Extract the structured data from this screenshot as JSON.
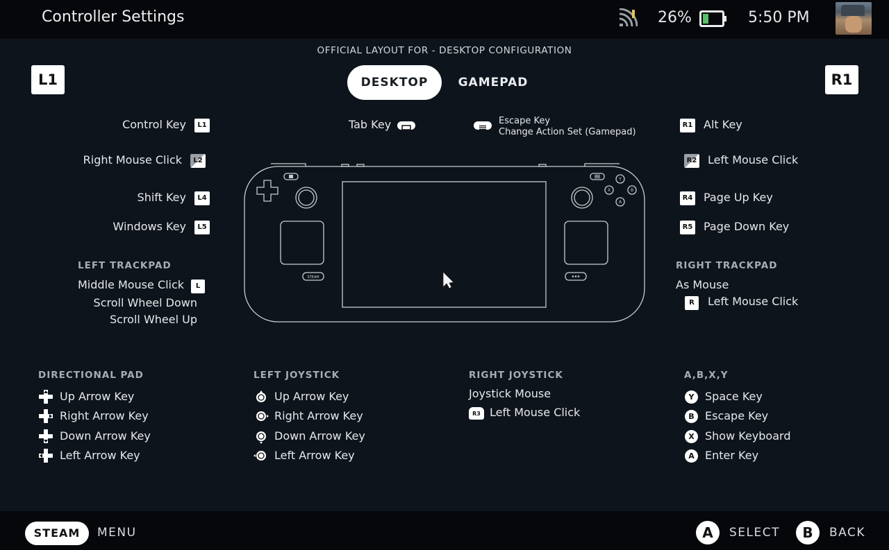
{
  "header": {
    "title": "Controller Settings",
    "battery": "26%",
    "time": "5:50 PM"
  },
  "layout_label": "OFFICIAL LAYOUT FOR - DESKTOP CONFIGURATION",
  "tabs": [
    {
      "label": "DESKTOP",
      "selected": true
    },
    {
      "label": "GAMEPAD",
      "selected": false
    }
  ],
  "shoulders": {
    "left": "L1",
    "right": "R1"
  },
  "left_bindings": {
    "l1": {
      "action": "Control Key",
      "badge": "L1"
    },
    "l2": {
      "action": "Right Mouse Click",
      "badge": "L2"
    },
    "l4": {
      "action": "Shift Key",
      "badge": "L4"
    },
    "l5": {
      "action": "Windows Key",
      "badge": "L5"
    }
  },
  "right_bindings": {
    "r1": {
      "action": "Alt Key",
      "badge": "R1"
    },
    "r2": {
      "action": "Left Mouse Click",
      "badge": "R2"
    },
    "r4": {
      "action": "Page Up Key",
      "badge": "R4"
    },
    "r5": {
      "action": "Page Down Key",
      "badge": "R5"
    }
  },
  "top_bindings": {
    "view": {
      "action": "Tab Key"
    },
    "menu": {
      "action": "Escape Key",
      "secondary": "Change Action Set (Gamepad)"
    }
  },
  "left_trackpad": {
    "heading": "LEFT TRACKPAD",
    "click": "Middle Mouse Click",
    "click_badge": "L",
    "down": "Scroll Wheel Down",
    "up": "Scroll Wheel Up"
  },
  "right_trackpad": {
    "heading": "RIGHT TRACKPAD",
    "mode": "As Mouse",
    "click": "Left Mouse Click",
    "click_badge": "R"
  },
  "device": {
    "steam_label": "STEAM"
  },
  "dpad": {
    "heading": "DIRECTIONAL PAD",
    "items": [
      "Up Arrow Key",
      "Right Arrow Key",
      "Down Arrow Key",
      "Left Arrow Key"
    ]
  },
  "left_joystick": {
    "heading": "LEFT JOYSTICK",
    "items": [
      "Up Arrow Key",
      "Right Arrow Key",
      "Down Arrow Key",
      "Left Arrow Key"
    ]
  },
  "right_joystick": {
    "heading": "RIGHT JOYSTICK",
    "mode": "Joystick Mouse",
    "click": "Left Mouse Click",
    "click_badge": "R3"
  },
  "face_buttons": {
    "heading": "A,B,X,Y",
    "items": [
      {
        "button": "Y",
        "action": "Space Key"
      },
      {
        "button": "B",
        "action": "Escape Key"
      },
      {
        "button": "X",
        "action": "Show Keyboard"
      },
      {
        "button": "A",
        "action": "Enter Key"
      }
    ]
  },
  "footer": {
    "steam": "STEAM",
    "menu": "MENU",
    "select_btn": "A",
    "select": "SELECT",
    "back_btn": "B",
    "back": "BACK"
  }
}
